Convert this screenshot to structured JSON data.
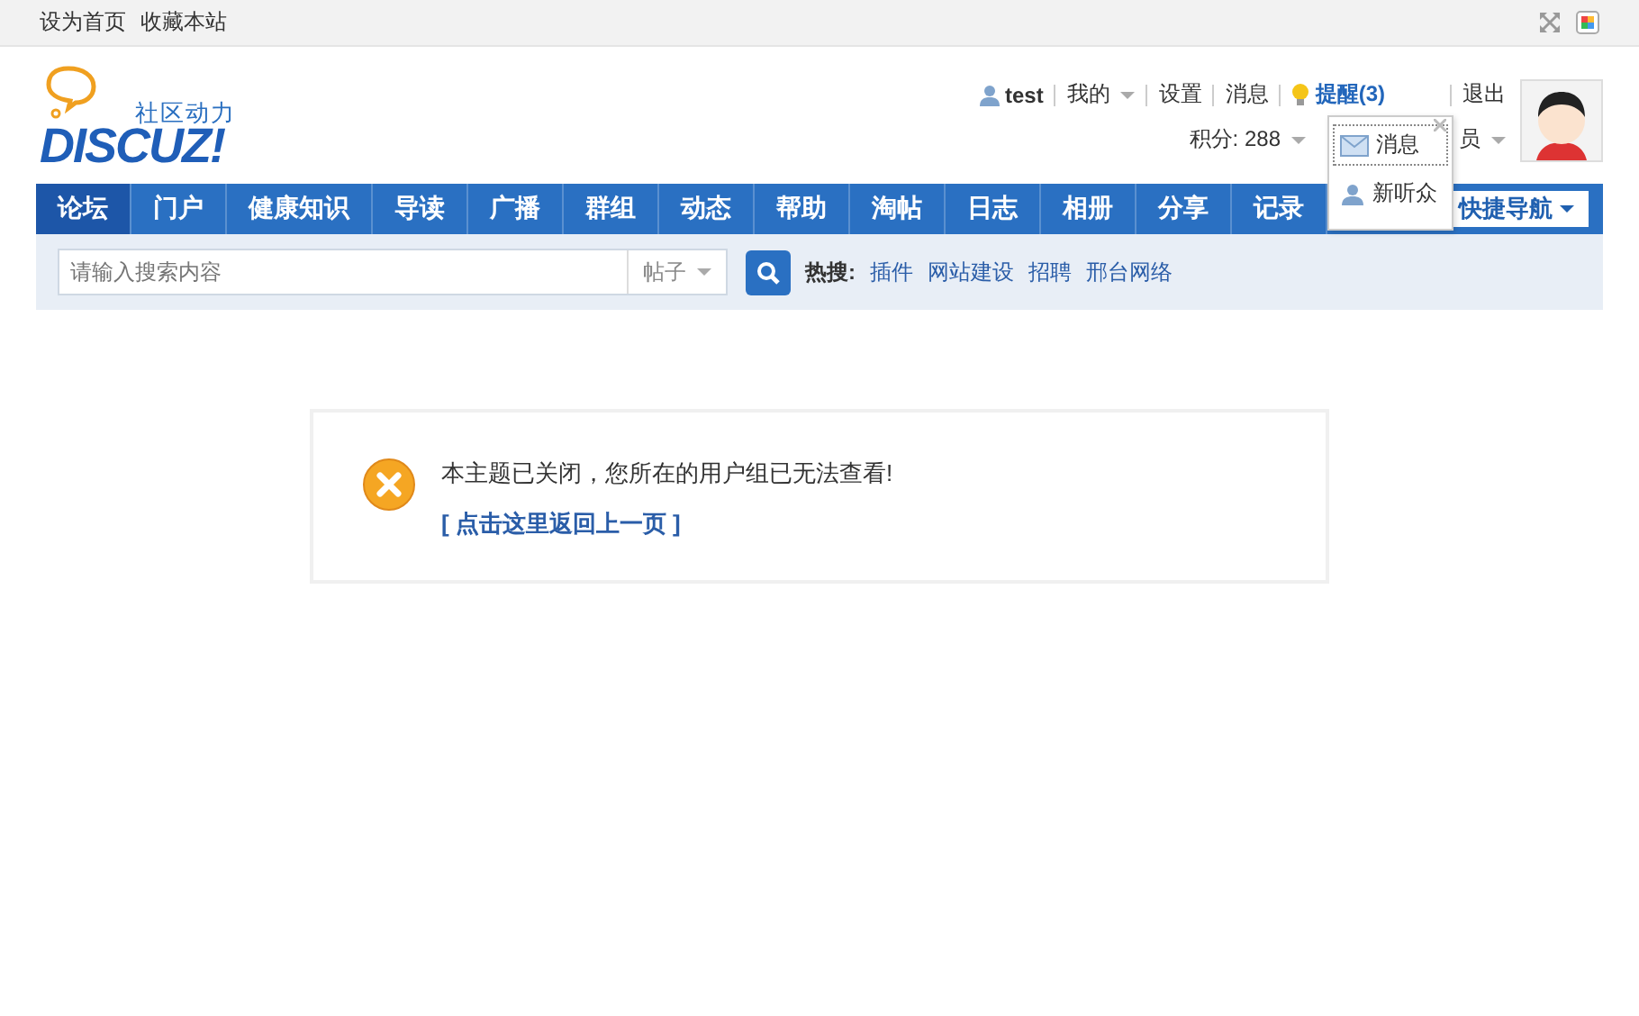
{
  "top_bar": {
    "links": [
      "设为首页",
      "收藏本站"
    ]
  },
  "logo": {
    "name": "DISCUZ!",
    "tagline": "社区动力"
  },
  "user_bar": {
    "username": "test",
    "my": "我的",
    "settings": "设置",
    "messages": "消息",
    "notices": "提醒(3)",
    "logout": "退出",
    "points": "积分: 288",
    "group": "员"
  },
  "notice_menu": {
    "items": [
      {
        "label": "消息",
        "selected": true
      },
      {
        "label": "新听众",
        "selected": false
      }
    ]
  },
  "nav": {
    "items": [
      {
        "label": "论坛",
        "selected": true
      },
      {
        "label": "门户",
        "selected": false
      },
      {
        "label": "健康知识",
        "selected": false
      },
      {
        "label": "导读",
        "selected": false
      },
      {
        "label": "广播",
        "selected": false
      },
      {
        "label": "群组",
        "selected": false
      },
      {
        "label": "动态",
        "selected": false
      },
      {
        "label": "帮助",
        "selected": false
      },
      {
        "label": "淘帖",
        "selected": false
      },
      {
        "label": "日志",
        "selected": false
      },
      {
        "label": "相册",
        "selected": false
      },
      {
        "label": "分享",
        "selected": false
      },
      {
        "label": "记录",
        "selected": false
      }
    ],
    "quick_nav": "快捷导航"
  },
  "search": {
    "placeholder": "请输入搜索内容",
    "type": "帖子",
    "hot_label": "热搜:",
    "hot": [
      "插件",
      "网站建设",
      "招聘",
      "邢台网络"
    ]
  },
  "message": {
    "text": "本主题已关闭，您所在的用户组已无法查看!",
    "link": "[ 点击这里返回上一页 ]"
  }
}
